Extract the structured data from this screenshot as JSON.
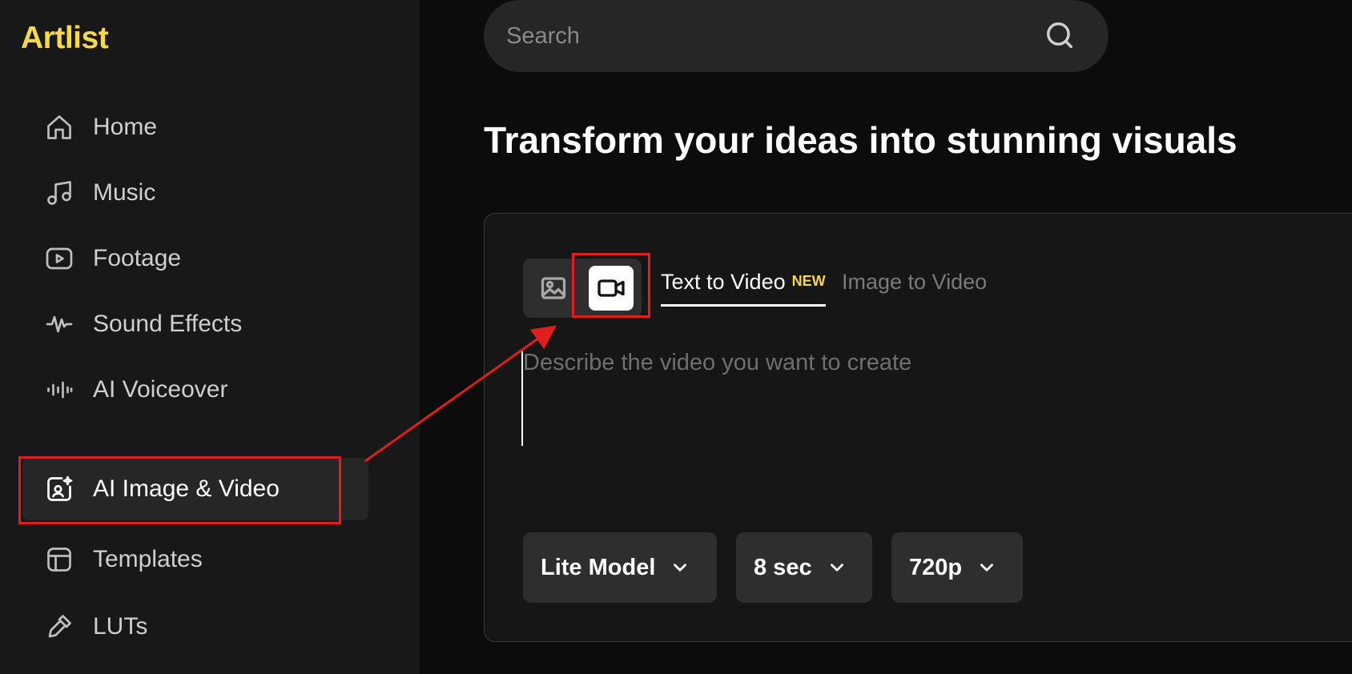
{
  "brand": {
    "name": "Artlist",
    "color": "#f5d94a"
  },
  "sidebar": {
    "items": [
      {
        "label": "Home",
        "icon": "home-icon"
      },
      {
        "label": "Music",
        "icon": "music-note-icon"
      },
      {
        "label": "Footage",
        "icon": "play-box-icon"
      },
      {
        "label": "Sound Effects",
        "icon": "waveform-icon"
      },
      {
        "label": "AI Voiceover",
        "icon": "voice-bars-icon"
      },
      {
        "label": "AI Image & Video",
        "icon": "ai-sparkle-image-icon",
        "active": true
      },
      {
        "label": "Templates",
        "icon": "template-layout-icon"
      },
      {
        "label": "LUTs",
        "icon": "dropper-icon"
      }
    ]
  },
  "search": {
    "placeholder": "Search"
  },
  "main": {
    "headline": "Transform your ideas into stunning visuals",
    "generator": {
      "modes": [
        {
          "name": "image",
          "icon": "image-icon"
        },
        {
          "name": "video",
          "icon": "video-camera-icon",
          "selected": true
        }
      ],
      "tabs": [
        {
          "label": "Text to Video",
          "badge": "NEW",
          "active": true
        },
        {
          "label": "Image to Video",
          "active": false
        }
      ],
      "prompt_placeholder": "Describe the video you want to create",
      "dropdowns": {
        "model": "Lite Model",
        "duration": "8 sec",
        "resolution": "720p"
      }
    }
  },
  "colors": {
    "accent": "#f5d94a",
    "annotation": "#e01e1e"
  }
}
